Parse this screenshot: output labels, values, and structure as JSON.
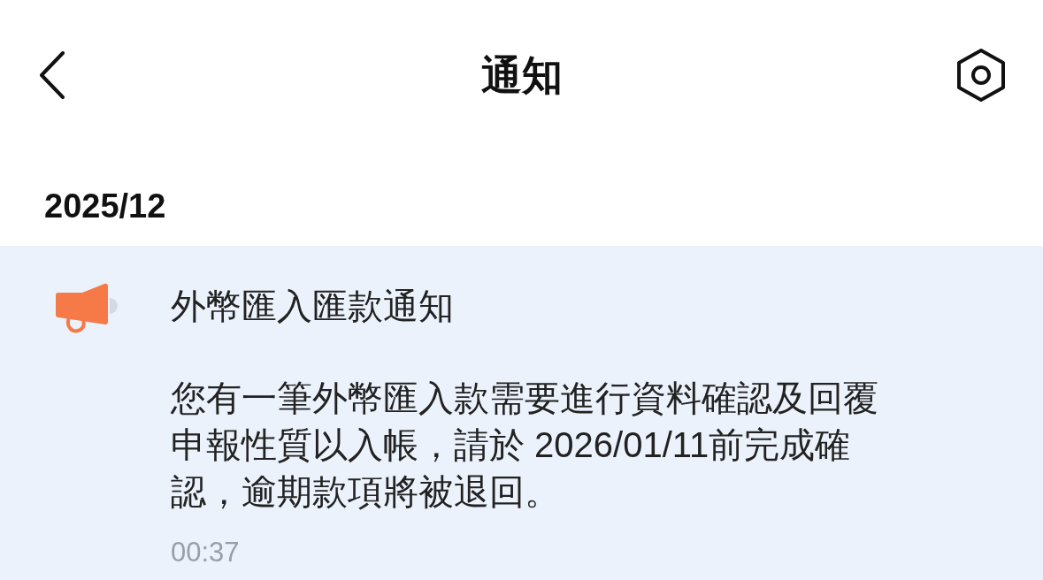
{
  "header": {
    "title": "通知"
  },
  "sections": [
    {
      "month": "2025/12",
      "notifications": [
        {
          "title": "外幣匯入匯款通知",
          "body": "您有一筆外幣匯入款需要進行資料確認及回覆申報性質以入帳，請於 2026/01/11前完成確認，逾期款項將被退回。",
          "time": "00:37"
        }
      ]
    }
  ]
}
